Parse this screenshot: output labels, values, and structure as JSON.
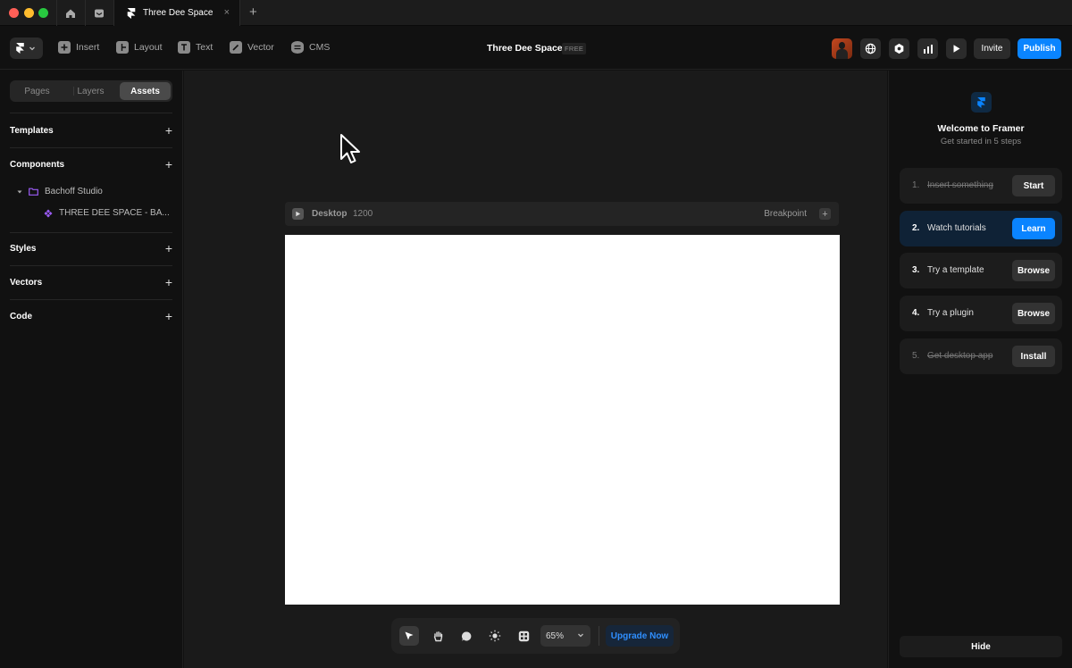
{
  "window": {
    "tab_title": "Three Dee Space",
    "tab_close": "×",
    "new_tab": "+"
  },
  "toolbar": {
    "items": [
      {
        "label": "Insert",
        "icon": "plus-square-icon"
      },
      {
        "label": "Layout",
        "icon": "layout-icon"
      },
      {
        "label": "Text",
        "icon": "text-icon"
      },
      {
        "label": "Vector",
        "icon": "pen-icon"
      },
      {
        "label": "CMS",
        "icon": "database-icon"
      }
    ],
    "project_title": "Three Dee Space",
    "plan_badge": "FREE",
    "invite_label": "Invite",
    "publish_label": "Publish"
  },
  "left_panel": {
    "tabs": [
      {
        "label": "Pages"
      },
      {
        "label": "Layers"
      },
      {
        "label": "Assets",
        "active": true
      }
    ],
    "sections": {
      "templates": "Templates",
      "components": "Components",
      "styles": "Styles",
      "vectors": "Vectors",
      "code": "Code"
    },
    "add_symbol": "+",
    "folder_name": "Bachoff Studio",
    "component_name": "THREE DEE SPACE - BA..."
  },
  "canvas": {
    "breakpoint_name": "Desktop",
    "breakpoint_width": "1200",
    "breakpoint_label": "Breakpoint",
    "breakpoint_add": "+"
  },
  "dock": {
    "tools": [
      "select-arrow-icon",
      "hand-icon",
      "comment-icon",
      "sun-icon",
      "grid-components-icon"
    ],
    "zoom": "65%",
    "upgrade_label": "Upgrade Now"
  },
  "right_panel": {
    "welcome_title": "Welcome to Framer",
    "welcome_subtitle": "Get started in 5 steps",
    "steps": [
      {
        "num": "1.",
        "text": "Insert something",
        "button": "Start",
        "done": true
      },
      {
        "num": "2.",
        "text": "Watch tutorials",
        "button": "Learn",
        "active": true
      },
      {
        "num": "3.",
        "text": "Try a template",
        "button": "Browse"
      },
      {
        "num": "4.",
        "text": "Try a plugin",
        "button": "Browse"
      },
      {
        "num": "5.",
        "text": "Get desktop app",
        "button": "Install",
        "done": true
      }
    ],
    "hide_label": "Hide"
  },
  "colors": {
    "accent": "#0a84ff",
    "component_purple": "#9b5cf6",
    "canvas_bg": "#1a1a1a",
    "panel_bg": "#111111"
  }
}
